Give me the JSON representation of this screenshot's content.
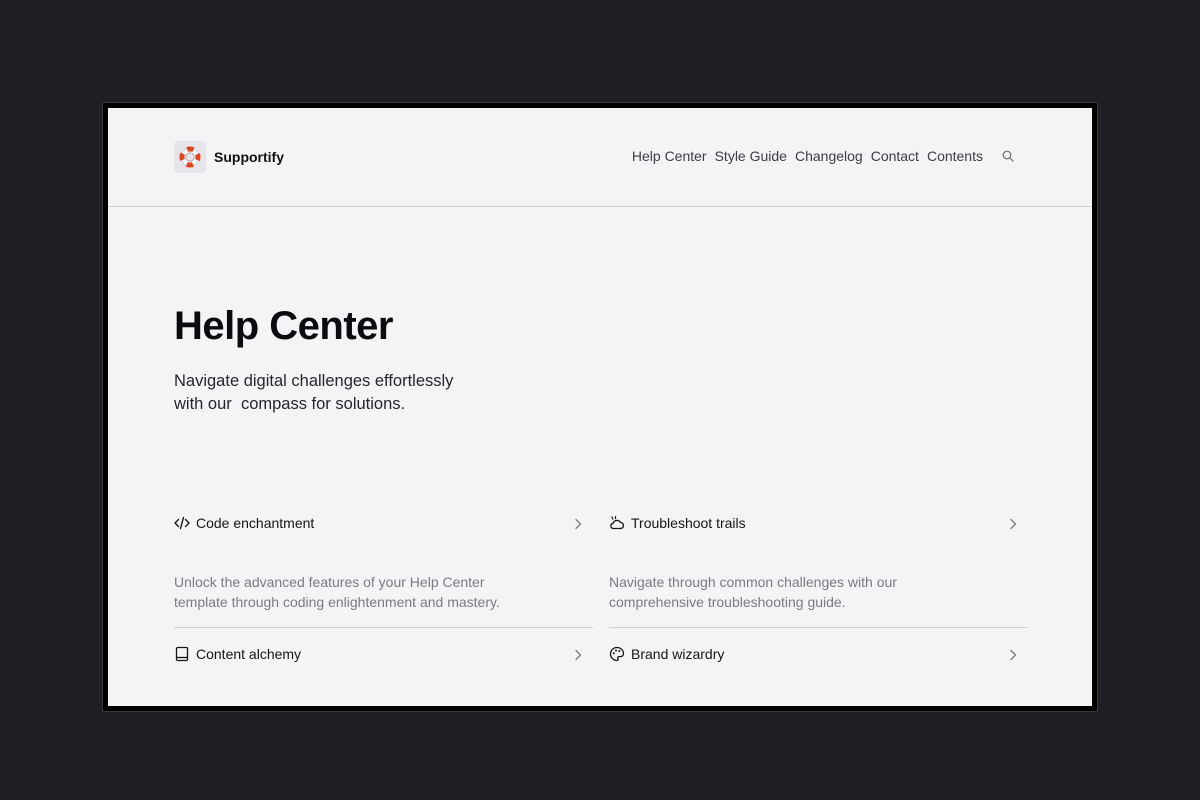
{
  "brand": {
    "name": "Supportify",
    "logo_icon": "lifebuoy-icon",
    "logo_colors": [
      "#e0451f",
      "#ffffff"
    ]
  },
  "nav": {
    "items": [
      {
        "label": "Help Center"
      },
      {
        "label": "Style Guide"
      },
      {
        "label": "Changelog"
      },
      {
        "label": "Contact"
      },
      {
        "label": "Contents"
      }
    ],
    "search_icon": "search-icon"
  },
  "hero": {
    "title": "Help Center",
    "subtitle": "Navigate digital challenges effortlessly\nwith our  compass for solutions."
  },
  "cards": [
    {
      "icon": "code-icon",
      "title": "Code enchantment",
      "description": "Unlock the advanced features of your Help Center template through coding enlightenment and mastery."
    },
    {
      "icon": "cloud-icon",
      "title": "Troubleshoot trails",
      "description": "Navigate through common challenges with our comprehensive troubleshooting guide."
    },
    {
      "icon": "book-icon",
      "title": "Content alchemy",
      "description": ""
    },
    {
      "icon": "palette-icon",
      "title": "Brand wizardry",
      "description": ""
    }
  ],
  "colors": {
    "background": "#1f1e24",
    "page": "#f4f4f6",
    "text": "#0c0c10",
    "muted_text": "#7a7a82",
    "divider": "#cfd0d4"
  }
}
